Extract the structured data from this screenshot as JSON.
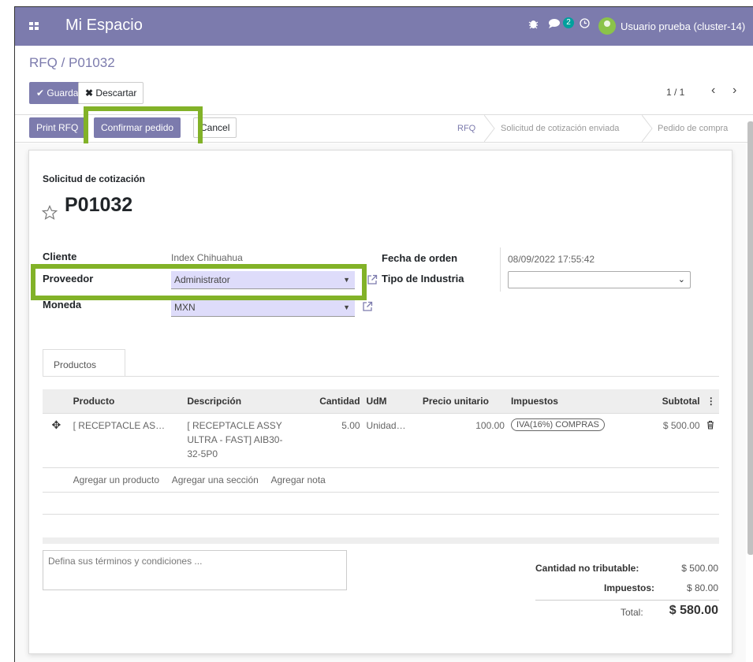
{
  "navbar": {
    "app_title": "Mi Espacio",
    "chat_count": "2",
    "user_name": "Usuario prueba (cluster-14)"
  },
  "breadcrumb": "RFQ / P01032",
  "actions": {
    "save": "Guardar",
    "discard": "Descartar"
  },
  "pager": {
    "value": "1 / 1"
  },
  "buttons": {
    "print_rfq": "Print RFQ",
    "confirm": "Confirmar pedido",
    "cancel": "Cancel"
  },
  "stages": [
    "RFQ",
    "Solicitud de cotización enviada",
    "Pedido de compra"
  ],
  "active_stage": "RFQ",
  "form": {
    "doc_type": "Solicitud de cotización",
    "doc_number": "P01032",
    "cliente_label": "Cliente",
    "cliente_value": "Index Chihuahua",
    "proveedor_label": "Proveedor",
    "proveedor_value": "Administrator",
    "moneda_label": "Moneda",
    "moneda_value": "MXN",
    "fecha_label": "Fecha de orden",
    "fecha_value": "08/09/2022 17:55:42",
    "industria_label": "Tipo de Industria",
    "industria_value": ""
  },
  "tabs": {
    "productos": "Productos"
  },
  "table": {
    "headers": [
      "Producto",
      "Descripción",
      "Cantidad",
      "UdM",
      "Precio unitario",
      "Impuestos",
      "Subtotal"
    ],
    "rows": [
      {
        "product": "[ RECEPTACLE AS…",
        "description": "[ RECEPTACLE ASSY ULTRA - FAST] AIB30-32-5P0",
        "qty": "5.00",
        "uom": "Unidad…",
        "price": "100.00",
        "tax": "IVA(16%) COMPRAS",
        "subtotal": "$ 500.00"
      }
    ],
    "add_product": "Agregar un producto",
    "add_section": "Agregar una sección",
    "add_note": "Agregar nota"
  },
  "terms_placeholder": "Defina sus términos y condiciones ...",
  "totals": {
    "untaxed_label": "Cantidad no tributable:",
    "untaxed_value": "$ 500.00",
    "taxes_label": "Impuestos:",
    "taxes_value": "$ 80.00",
    "total_label": "Total:",
    "total_value": "$ 580.00"
  },
  "colors": {
    "brand": "#7c7bad",
    "highlight": "#82b228",
    "field_bg": "#dedcfa",
    "badge": "#00a09d"
  },
  "icons": [
    "apps-icon",
    "bug-icon",
    "chat-icon",
    "clock-icon",
    "user-avatar-icon",
    "check-icon",
    "times-icon",
    "chevron-left-icon",
    "chevron-right-icon",
    "star-icon",
    "external-link-icon",
    "drag-handle-icon",
    "trash-icon",
    "options-icon",
    "caret-down-icon"
  ]
}
